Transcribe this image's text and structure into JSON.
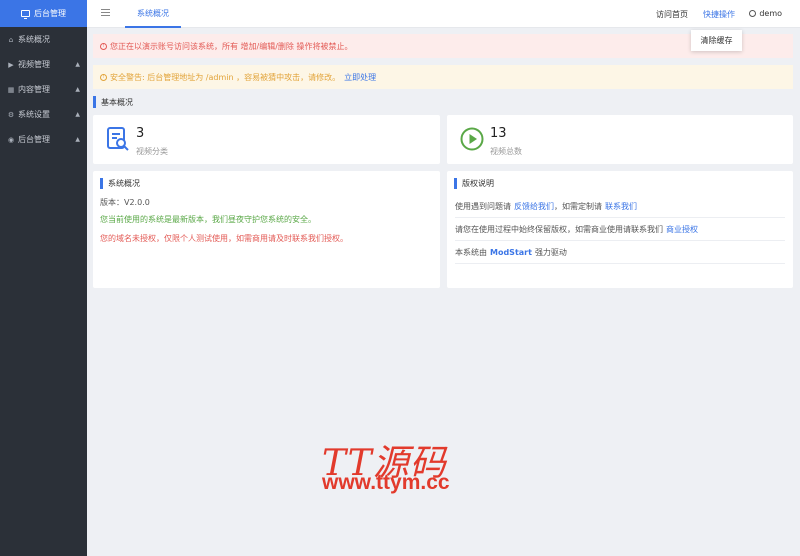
{
  "sidebar": {
    "brand": "后台管理",
    "items": [
      {
        "label": "系统概况",
        "icon": "home-icon",
        "arrow": false
      },
      {
        "label": "视频管理",
        "icon": "play-circle-icon",
        "arrow": true
      },
      {
        "label": "内容管理",
        "icon": "grid-icon",
        "arrow": true
      },
      {
        "label": "系统设置",
        "icon": "gear-icon",
        "arrow": true
      },
      {
        "label": "后台管理",
        "icon": "user-circle-icon",
        "arrow": true
      }
    ]
  },
  "header": {
    "tab": "系统概况",
    "visit_home": "访问首页",
    "quick_ops": "快捷操作",
    "user": "demo",
    "dropdown_item": "清除缓存"
  },
  "alerts": {
    "demo": "您正在以演示账号访问该系统，所有 增加/编辑/删除 操作将被禁止。",
    "security": "安全警告: 后台管理地址为 /admin ，容易被猜中攻击，请修改。",
    "security_link": "立即处理"
  },
  "basic": {
    "title": "基本概况",
    "stats": [
      {
        "value": "3",
        "label": "视频分类"
      },
      {
        "value": "13",
        "label": "视频总数"
      }
    ]
  },
  "system_panel": {
    "title": "系统概况",
    "version": "版本：V2.0.0",
    "latest": "您当前使用的系统是最新版本，我们昼夜守护您系统的安全。",
    "unlicensed": "您的域名未授权，仅限个人测试使用，如需商用请及时联系我们授权。"
  },
  "copyright_panel": {
    "title": "版权说明",
    "line1_text": "使用遇到问题请",
    "line1_link1": "反馈给我们",
    "line1_mid": "，如需定制请",
    "line1_link2": "联系我们",
    "line2_text": "请您在使用过程中始终保留版权，如需商业使用请联系我们",
    "line2_link": "商业授权",
    "line3_prefix": "本系统由",
    "line3_brand": "ModStart",
    "line3_suffix": "强力驱动"
  },
  "watermark": {
    "title": "TT源码",
    "url": "www.ttym.cc"
  },
  "colors": {
    "primary": "#3b75e6",
    "sidebar_bg": "#2b3038",
    "danger": "#e35a55",
    "warning": "#e2a43b",
    "success": "#5aa847",
    "watermark": "#e23a2c"
  }
}
